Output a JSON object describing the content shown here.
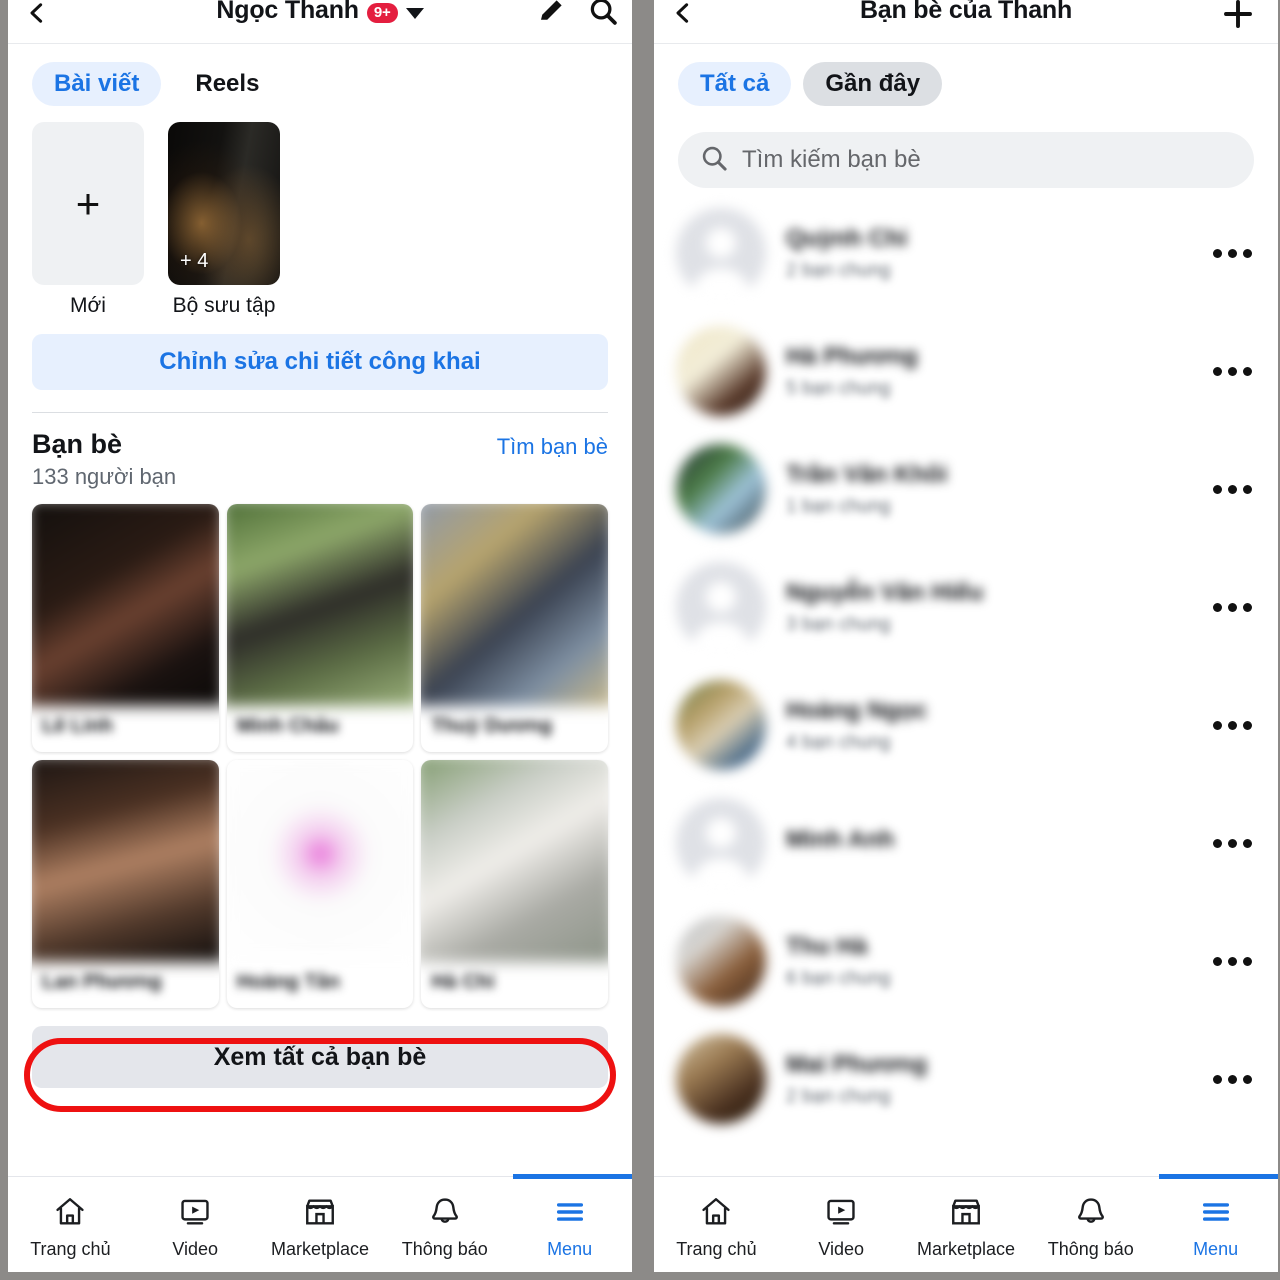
{
  "left_panel": {
    "topbar": {
      "back_icon": "chevron-left-icon",
      "title": "Ngọc Thanh",
      "badge": "9+",
      "dropdown_icon": "chevron-down-icon",
      "edit_icon": "pencil-icon",
      "search_icon": "search-icon"
    },
    "tabs": [
      {
        "label": "Bài viết",
        "state": "active"
      },
      {
        "label": "Reels",
        "state": "plain"
      }
    ],
    "highlights": [
      {
        "label": "Mới",
        "type": "new",
        "plus": "+"
      },
      {
        "label": "Bộ sưu tập",
        "type": "photo",
        "count": "+ 4"
      }
    ],
    "edit_public_details": "Chỉnh sửa chi tiết công khai",
    "friends": {
      "title": "Bạn bè",
      "count_text": "133 người bạn",
      "find_link": "Tìm bạn bè",
      "grid": [
        {
          "name": "",
          "tone": "dark"
        },
        {
          "name": "",
          "tone": "green"
        },
        {
          "name": "",
          "tone": "blue"
        },
        {
          "name": "",
          "tone": "portrait"
        },
        {
          "name": "",
          "tone": "white"
        },
        {
          "name": "",
          "tone": "street"
        }
      ],
      "see_all_label": "Xem tất cả bạn bè",
      "highlight_color": "#ee1111"
    },
    "bottom_nav": [
      {
        "label": "Trang chủ",
        "icon": "home-icon",
        "active": false
      },
      {
        "label": "Video",
        "icon": "video-icon",
        "active": false
      },
      {
        "label": "Marketplace",
        "icon": "marketplace-icon",
        "active": false
      },
      {
        "label": "Thông báo",
        "icon": "bell-icon",
        "active": false
      },
      {
        "label": "Menu",
        "icon": "hamburger-icon",
        "active": true
      }
    ]
  },
  "right_panel": {
    "topbar": {
      "back_icon": "chevron-left-icon",
      "title": "Bạn bè của Thanh",
      "add_icon": "plus-icon"
    },
    "tabs": [
      {
        "label": "Tất cả",
        "state": "active"
      },
      {
        "label": "Gần đây",
        "state": "grey"
      }
    ],
    "search": {
      "placeholder": "Tìm kiếm bạn bè",
      "icon": "search-icon"
    },
    "friend_rows": [
      {
        "name": "",
        "subtitle": "",
        "avatar": "placeholder",
        "menu_icon": "more-options-icon"
      },
      {
        "name": "",
        "subtitle": "",
        "avatar": "cream",
        "menu_icon": "more-options-icon"
      },
      {
        "name": "",
        "subtitle": "",
        "avatar": "scenic",
        "menu_icon": "more-options-icon"
      },
      {
        "name": "",
        "subtitle": "",
        "avatar": "placeholder",
        "menu_icon": "more-options-icon"
      },
      {
        "name": "",
        "subtitle": "",
        "avatar": "outdoor",
        "menu_icon": "more-options-icon"
      },
      {
        "name": "",
        "subtitle": "",
        "avatar": "placeholder",
        "menu_icon": "more-options-icon"
      },
      {
        "name": "",
        "subtitle": "",
        "avatar": "warm",
        "menu_icon": "more-options-icon"
      },
      {
        "name": "",
        "subtitle": "",
        "avatar": "brown",
        "menu_icon": "more-options-icon"
      }
    ],
    "bottom_nav": [
      {
        "label": "Trang chủ",
        "icon": "home-icon",
        "active": false
      },
      {
        "label": "Video",
        "icon": "video-icon",
        "active": false
      },
      {
        "label": "Marketplace",
        "icon": "marketplace-icon",
        "active": false
      },
      {
        "label": "Thông báo",
        "icon": "bell-icon",
        "active": false
      },
      {
        "label": "Menu",
        "icon": "hamburger-icon",
        "active": true
      }
    ]
  },
  "colors": {
    "accent": "#1b74e4",
    "accent_bg": "#e7f0fe",
    "badge_red": "#e41e3f",
    "annotation_red": "#ee1111",
    "grey_button": "#e4e6eb",
    "frame": "#8c8a88"
  }
}
